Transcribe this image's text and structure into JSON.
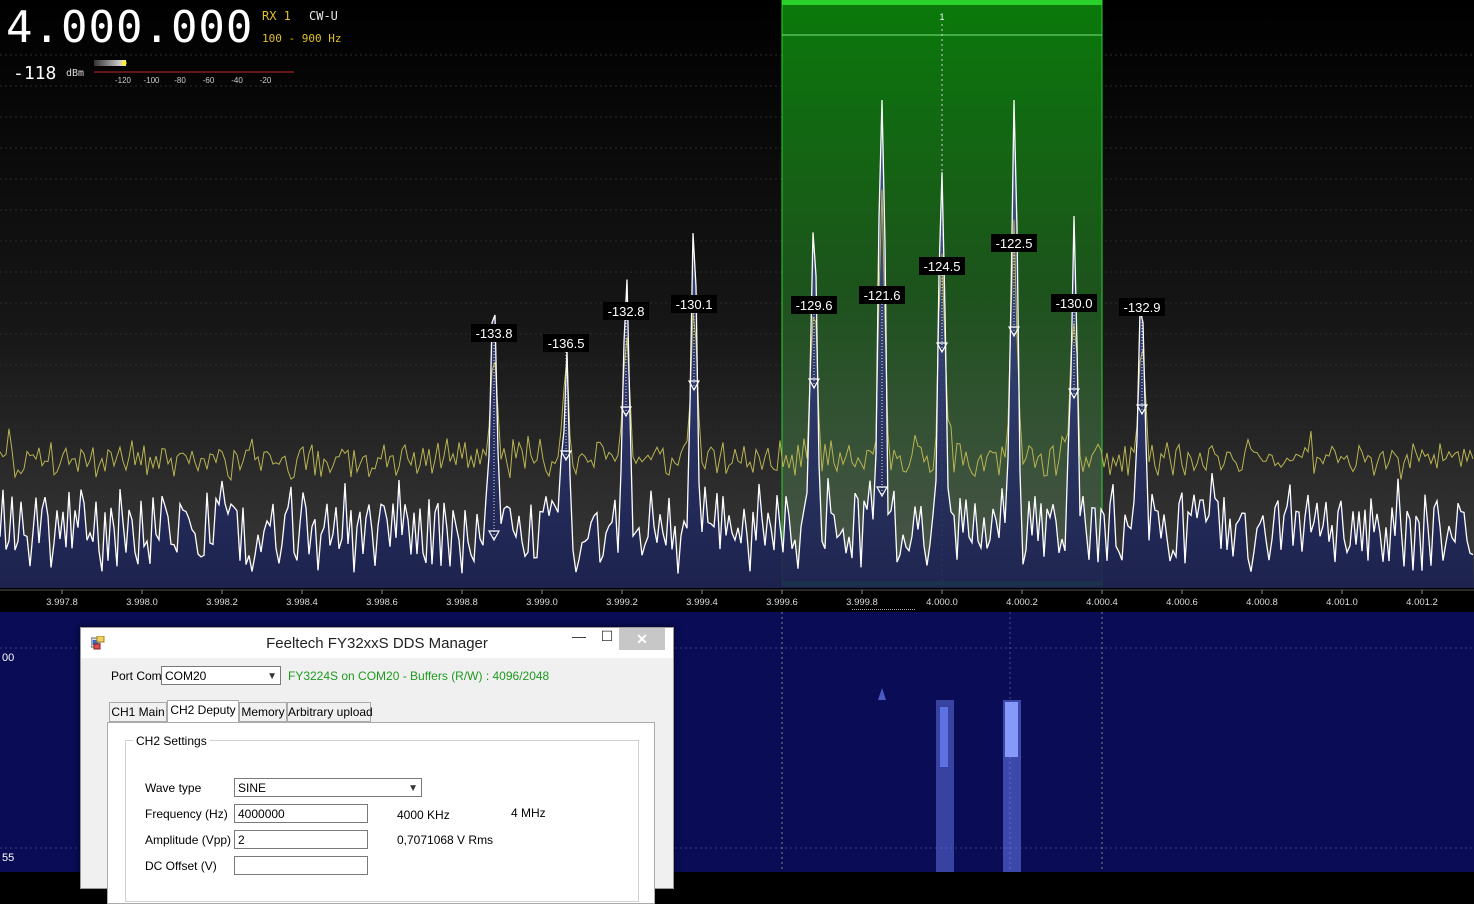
{
  "receiver": {
    "frequency": "4.000.000",
    "rx": "RX 1",
    "mode": "CW-U",
    "bandwidth": "100 - 900 Hz",
    "signal_value": "-118",
    "signal_unit": "dBm",
    "smeter_ticks": [
      "-120",
      "-100",
      "-80",
      "-60",
      "-40",
      "-20"
    ]
  },
  "spectrum": {
    "freq_axis_labels": [
      "3.997.8",
      "3.998.0",
      "3.998.2",
      "3.998.4",
      "3.998.6",
      "3.998.8",
      "3.999.0",
      "3.999.2",
      "3.999.4",
      "3.999.6",
      "3.999.8",
      "4.000.0",
      "4.000.2",
      "4.000.4",
      "4.000.6",
      "4.000.8",
      "4.001.0",
      "4.001.2"
    ],
    "freq_axis_values": [
      3997.8,
      3998.0,
      3998.2,
      3998.4,
      3998.6,
      3998.8,
      3999.0,
      3999.2,
      3999.4,
      3999.6,
      3999.8,
      4000.0,
      4000.2,
      4000.4,
      4000.6,
      4000.8,
      4001.0,
      4001.2
    ],
    "filter_low_khz": 3999.6,
    "filter_high_khz": 4000.4,
    "vfo_marker": "1",
    "peaks": [
      {
        "freq": 3998.88,
        "label": "-133.8"
      },
      {
        "freq": 3999.06,
        "label": "-136.5"
      },
      {
        "freq": 3999.21,
        "label": "-132.8"
      },
      {
        "freq": 3999.38,
        "label": "-130.1"
      },
      {
        "freq": 3999.68,
        "label": "-129.6"
      },
      {
        "freq": 3999.85,
        "label": "-121.6"
      },
      {
        "freq": 4000.0,
        "label": "-124.5"
      },
      {
        "freq": 4000.18,
        "label": "-122.5"
      },
      {
        "freq": 4000.33,
        "label": "-130.0"
      },
      {
        "freq": 4000.5,
        "label": "-132.9"
      }
    ],
    "colors": {
      "filter": "#1fa31f",
      "peak_trace": "#c7c35a",
      "live_trace": "#ffffff",
      "fill": "#2a3260"
    }
  },
  "waterfall": {
    "label_top": "00",
    "label_bottom": "55",
    "background": "#0a0c55",
    "signal_color": "#6f86ff"
  },
  "dialog": {
    "title": "Feeltech FY32xxS DDS Manager",
    "minimize_icon": "—",
    "maximize_icon": "☐",
    "close_icon": "✕",
    "port_label": "Port Com",
    "port_value": "COM20",
    "port_status": "FY3224S on COM20 - Buffers (R/W) : 4096/2048",
    "tabs": [
      "CH1 Main",
      "CH2 Deputy",
      "Memory",
      "Arbitrary upload"
    ],
    "group_title": "CH2 Settings",
    "wave_label": "Wave type",
    "wave_value": "SINE",
    "freq_label": "Frequency (Hz)",
    "freq_value": "4000000",
    "freq_khz": "4000 KHz",
    "freq_mhz": "4 MHz",
    "amp_label": "Amplitude (Vpp)",
    "amp_value": "2",
    "amp_rms": "0,7071068 V Rms",
    "dc_label": "DC Offset (V)",
    "dc_value": ""
  }
}
